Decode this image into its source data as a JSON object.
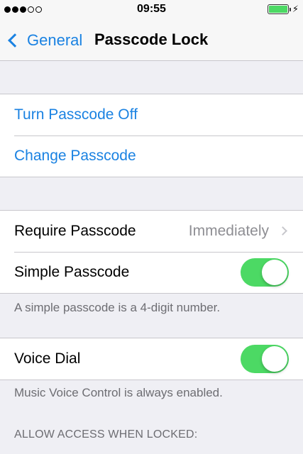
{
  "status_bar": {
    "time": "09:55",
    "signal_bars_filled": 3,
    "signal_bars_total": 5,
    "battery_level": 1.0,
    "charging_icon": "⚡"
  },
  "nav": {
    "back_label": "General",
    "title": "Passcode Lock"
  },
  "group1": {
    "turn_off_label": "Turn Passcode Off",
    "change_label": "Change Passcode"
  },
  "group2": {
    "require_label": "Require Passcode",
    "require_value": "Immediately",
    "simple_label": "Simple Passcode",
    "simple_on": true,
    "footer": "A simple passcode is a 4-digit number."
  },
  "group3": {
    "voice_dial_label": "Voice Dial",
    "voice_dial_on": true,
    "footer": "Music Voice Control is always enabled."
  },
  "section_header": "ALLOW ACCESS WHEN LOCKED:",
  "colors": {
    "accent": "#1a82e2",
    "toggle_on": "#4cd964",
    "background": "#efeff4",
    "secondary_text": "#8e8e93"
  },
  "icons": {
    "back": "chevron-left-icon",
    "disclosure": "chevron-right-icon",
    "battery": "battery-icon",
    "charging": "bolt-icon"
  }
}
